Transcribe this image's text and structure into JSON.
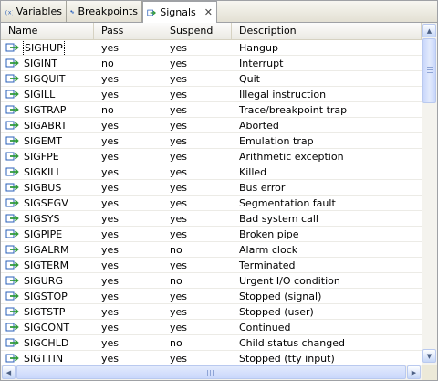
{
  "tabs": [
    {
      "label": "Variables",
      "icon": "variables-icon",
      "active": false
    },
    {
      "label": "Breakpoints",
      "icon": "breakpoints-icon",
      "active": false
    },
    {
      "label": "Signals",
      "icon": "signals-icon",
      "active": true,
      "close_glyph": "✕"
    }
  ],
  "table": {
    "columns": [
      "Name",
      "Pass",
      "Suspend",
      "Description"
    ],
    "rows": [
      {
        "name": "SIGHUP",
        "pass": "yes",
        "suspend": "yes",
        "description": "Hangup"
      },
      {
        "name": "SIGINT",
        "pass": "no",
        "suspend": "yes",
        "description": "Interrupt"
      },
      {
        "name": "SIGQUIT",
        "pass": "yes",
        "suspend": "yes",
        "description": "Quit"
      },
      {
        "name": "SIGILL",
        "pass": "yes",
        "suspend": "yes",
        "description": "Illegal instruction"
      },
      {
        "name": "SIGTRAP",
        "pass": "no",
        "suspend": "yes",
        "description": "Trace/breakpoint trap"
      },
      {
        "name": "SIGABRT",
        "pass": "yes",
        "suspend": "yes",
        "description": "Aborted"
      },
      {
        "name": "SIGEMT",
        "pass": "yes",
        "suspend": "yes",
        "description": "Emulation trap"
      },
      {
        "name": "SIGFPE",
        "pass": "yes",
        "suspend": "yes",
        "description": "Arithmetic exception"
      },
      {
        "name": "SIGKILL",
        "pass": "yes",
        "suspend": "yes",
        "description": "Killed"
      },
      {
        "name": "SIGBUS",
        "pass": "yes",
        "suspend": "yes",
        "description": "Bus error"
      },
      {
        "name": "SIGSEGV",
        "pass": "yes",
        "suspend": "yes",
        "description": "Segmentation fault"
      },
      {
        "name": "SIGSYS",
        "pass": "yes",
        "suspend": "yes",
        "description": "Bad system call"
      },
      {
        "name": "SIGPIPE",
        "pass": "yes",
        "suspend": "yes",
        "description": "Broken pipe"
      },
      {
        "name": "SIGALRM",
        "pass": "yes",
        "suspend": "no",
        "description": "Alarm clock"
      },
      {
        "name": "SIGTERM",
        "pass": "yes",
        "suspend": "yes",
        "description": "Terminated"
      },
      {
        "name": "SIGURG",
        "pass": "yes",
        "suspend": "no",
        "description": "Urgent I/O condition"
      },
      {
        "name": "SIGSTOP",
        "pass": "yes",
        "suspend": "yes",
        "description": "Stopped (signal)"
      },
      {
        "name": "SIGTSTP",
        "pass": "yes",
        "suspend": "yes",
        "description": "Stopped (user)"
      },
      {
        "name": "SIGCONT",
        "pass": "yes",
        "suspend": "yes",
        "description": "Continued"
      },
      {
        "name": "SIGCHLD",
        "pass": "yes",
        "suspend": "no",
        "description": "Child status changed"
      },
      {
        "name": "SIGTTIN",
        "pass": "yes",
        "suspend": "yes",
        "description": "Stopped (tty input)"
      }
    ]
  },
  "row_icon": "signal-icon",
  "scrollbars": {
    "vertical": {
      "up_glyph": "▲",
      "down_glyph": "▼"
    },
    "horizontal": {
      "left_glyph": "◀",
      "right_glyph": "▶"
    }
  },
  "colors": {
    "icon_green": "#2f9a3a",
    "icon_blue": "#2a5fb8",
    "scroll_button": "#c6d6f7"
  }
}
